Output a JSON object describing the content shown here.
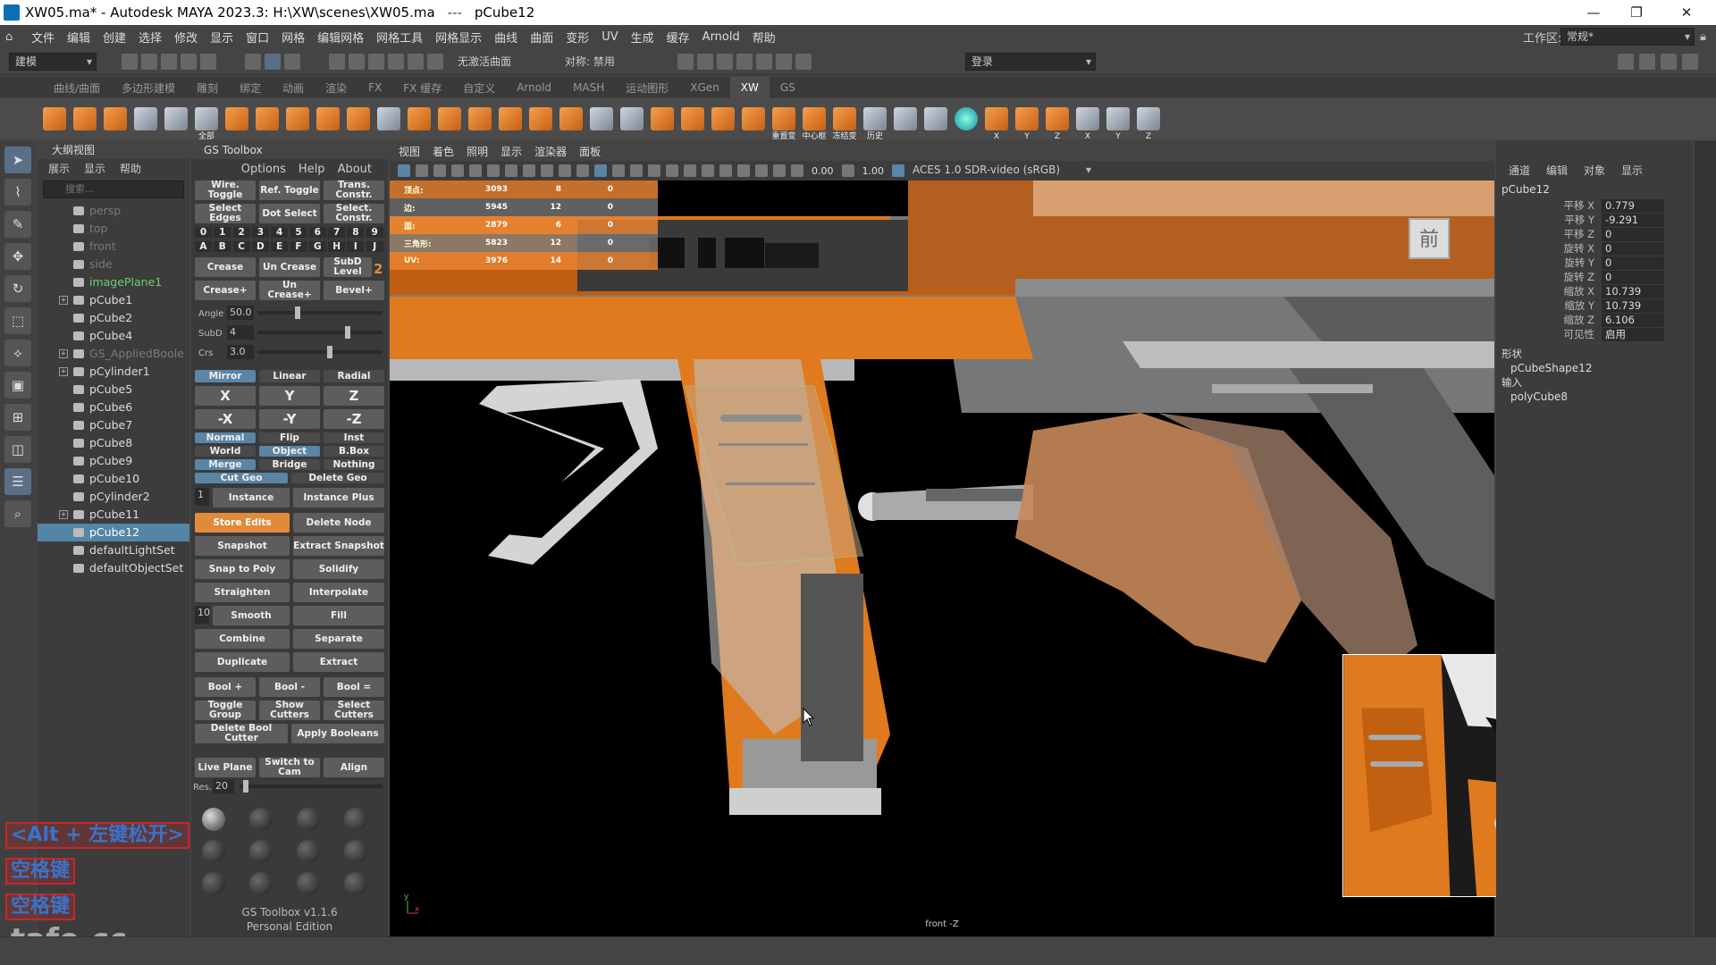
{
  "title": {
    "file": "XW05.ma* - Autodesk MAYA 2023.3: H:\\XW\\scenes\\XW05.ma",
    "sep": "---",
    "object": "pCube12"
  },
  "menu": [
    "文件",
    "编辑",
    "创建",
    "选择",
    "修改",
    "显示",
    "窗口",
    "网格",
    "编辑网格",
    "网格工具",
    "网格显示",
    "曲线",
    "曲面",
    "变形",
    "UV",
    "生成",
    "缓存",
    "Arnold",
    "帮助"
  ],
  "workspace": {
    "label": "工作区:",
    "value": "常规*"
  },
  "status": {
    "mode": "建模",
    "live_surface": "无激活曲面",
    "symmetry": "对称: 禁用",
    "login": "登录"
  },
  "shelf_tabs": [
    "曲线/曲面",
    "多边形建模",
    "雕刻",
    "绑定",
    "动画",
    "渲染",
    "FX",
    "FX 缓存",
    "自定义",
    "Arnold",
    "MASH",
    "运动图形",
    "XGen",
    "XW",
    "GS"
  ],
  "shelf_active": "XW",
  "shelf_captions": {
    "all": "全部",
    "reset": "重置变",
    "center": "中心枢",
    "freeze": "冻结变",
    "history": "历史",
    "x": "X",
    "y": "Y",
    "z": "Z"
  },
  "outliner": {
    "title": "大纲视图",
    "menu": [
      "展示",
      "显示",
      "帮助"
    ],
    "search_placeholder": "搜索...",
    "items": [
      {
        "name": "persp",
        "style": "dim"
      },
      {
        "name": "top",
        "style": "dim"
      },
      {
        "name": "front",
        "style": "dim"
      },
      {
        "name": "side",
        "style": "dim"
      },
      {
        "name": "imagePlane1",
        "style": "grn"
      },
      {
        "name": "pCube1",
        "style": ""
      },
      {
        "name": "pCube2",
        "style": ""
      },
      {
        "name": "pCube4",
        "style": ""
      },
      {
        "name": "GS_AppliedBoole",
        "style": "dim"
      },
      {
        "name": "pCylinder1",
        "style": ""
      },
      {
        "name": "pCube5",
        "style": ""
      },
      {
        "name": "pCube6",
        "style": ""
      },
      {
        "name": "pCube7",
        "style": ""
      },
      {
        "name": "pCube8",
        "style": ""
      },
      {
        "name": "pCube9",
        "style": ""
      },
      {
        "name": "pCube10",
        "style": ""
      },
      {
        "name": "pCylinder2",
        "style": ""
      },
      {
        "name": "pCube11",
        "style": ""
      },
      {
        "name": "pCube12",
        "style": "sel"
      },
      {
        "name": "defaultLightSet",
        "style": ""
      },
      {
        "name": "defaultObjectSet",
        "style": ""
      }
    ]
  },
  "watermark": {
    "line1": "<Alt + 左键松开>",
    "line2": "空格键",
    "line3": "空格键",
    "logo": "tafe.cc"
  },
  "gs": {
    "title": "GS Toolbox",
    "tabs": [
      "Options",
      "Help",
      "About"
    ],
    "wire_toggle": "Wire. Toggle",
    "ref_toggle": "Ref. Toggle",
    "trans_constr": "Trans. Constr.",
    "select_edges": "Select Edges",
    "dot_select": "Dot Select",
    "select_constr": "Select. Constr.",
    "numbers": [
      "0",
      "1",
      "2",
      "3",
      "4",
      "5",
      "6",
      "7",
      "8",
      "9"
    ],
    "letters": [
      "A",
      "B",
      "C",
      "D",
      "E",
      "F",
      "G",
      "H",
      "I",
      "J"
    ],
    "crease": "Crease",
    "uncrease": "Un Crease",
    "subd_level": "SubD Level",
    "subd_num": "2",
    "crease_plus": "Crease+",
    "uncrease_plus": "Un Crease+",
    "bevel_plus": "Bevel+",
    "angle_label": "Angle",
    "angle_val": "50.0",
    "subd_label": "SubD",
    "subd_val": "4",
    "crs_label": "Crs",
    "crs_val": "3.0",
    "mirror": "Mirror",
    "linear": "Linear",
    "radial": "Radial",
    "x": "X",
    "y": "Y",
    "z": "Z",
    "nx": "-X",
    "ny": "-Y",
    "nz": "-Z",
    "normal": "Normal",
    "flip": "Flip",
    "inst": "Inst",
    "world": "World",
    "object": "Object",
    "bbox": "B.Box",
    "merge": "Merge",
    "bridge": "Bridge",
    "nothing": "Nothing",
    "cut_geo": "Cut Geo",
    "delete_geo": "Delete Geo",
    "inst_num": "1",
    "instance": "Instance",
    "instance_plus": "Instance Plus",
    "store_edits": "Store Edits",
    "delete_node": "Delete Node",
    "snapshot": "Snapshot",
    "extract_snapshot": "Extract Snapshot",
    "snap_to_poly": "Snap to Poly",
    "solidify": "Solidify",
    "straighten": "Straighten",
    "interpolate": "Interpolate",
    "smooth_num": "10",
    "smooth": "Smooth",
    "fill": "Fill",
    "combine": "Combine",
    "separate": "Separate",
    "duplicate": "Duplicate",
    "extract": "Extract",
    "bool_plus": "Bool +",
    "bool_minus": "Bool -",
    "bool_eq": "Bool =",
    "toggle_group": "Toggle Group",
    "show_cutters": "Show Cutters",
    "select_cutters": "Select Cutters",
    "delete_bool_cutter": "Delete Bool Cutter",
    "apply_booleans": "Apply Booleans",
    "live_plane": "Live Plane",
    "switch_to_cam": "Switch to Cam",
    "align": "Align",
    "res_label": "Res.",
    "res_val": "20",
    "version": "GS Toolbox v1.1.6",
    "edition": "Personal Edition"
  },
  "viewport": {
    "menu": [
      "视图",
      "着色",
      "照明",
      "显示",
      "渲染器",
      "面板"
    ],
    "exposure": "0.00",
    "gamma": "1.00",
    "colorspace": "ACES 1.0 SDR-video (sRGB)",
    "hud": [
      {
        "k": "顶点:",
        "a": "3093",
        "b": "8",
        "c": "0"
      },
      {
        "k": "边:",
        "a": "5945",
        "b": "12",
        "c": "0"
      },
      {
        "k": "面:",
        "a": "2879",
        "b": "6",
        "c": "0"
      },
      {
        "k": "三角形:",
        "a": "5823",
        "b": "12",
        "c": "0"
      },
      {
        "k": "UV:",
        "a": "3976",
        "b": "14",
        "c": "0"
      }
    ],
    "view_label": "front -Z",
    "badge": "前",
    "axis_x": "x",
    "axis_y": "y"
  },
  "channel": {
    "tabs": [
      "通道",
      "编辑",
      "对象",
      "显示"
    ],
    "object": "pCube12",
    "attrs": [
      {
        "k": "平移 X",
        "v": "0.779"
      },
      {
        "k": "平移 Y",
        "v": "-9.291"
      },
      {
        "k": "平移 Z",
        "v": "0"
      },
      {
        "k": "旋转 X",
        "v": "0"
      },
      {
        "k": "旋转 Y",
        "v": "0"
      },
      {
        "k": "旋转 Z",
        "v": "0"
      },
      {
        "k": "缩放 X",
        "v": "10.739"
      },
      {
        "k": "缩放 Y",
        "v": "10.739"
      },
      {
        "k": "缩放 Z",
        "v": "6.106"
      },
      {
        "k": "可见性",
        "v": "启用"
      }
    ],
    "shapes_label": "形状",
    "shape": "pCubeShape12",
    "inputs_label": "输入",
    "input": "polyCube8"
  },
  "colors": {
    "accent": "#e08a3a",
    "selection": "#5285a6",
    "gun_orange": "#e07a1e"
  }
}
